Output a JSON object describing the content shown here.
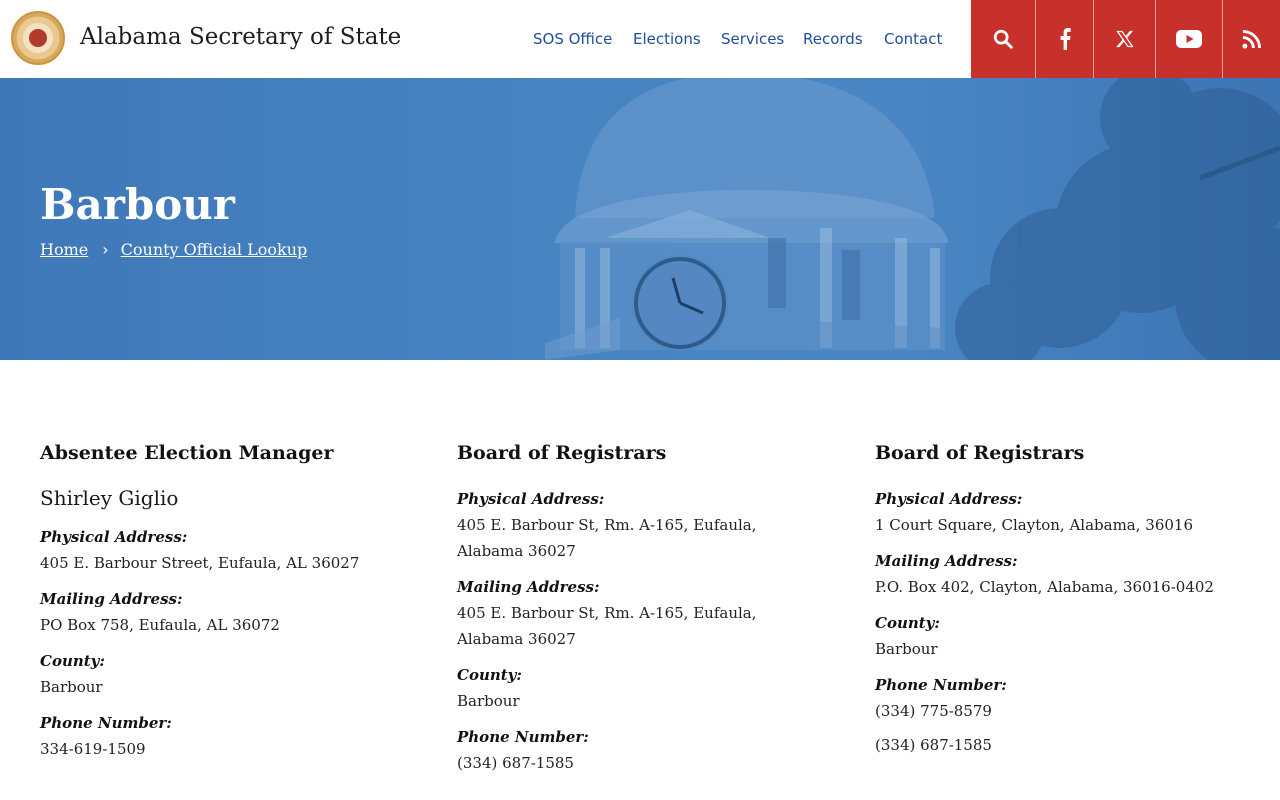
{
  "header": {
    "site_title": "Alabama Secretary of State",
    "logo_icon": "state-seal-icon",
    "nav": [
      {
        "label": "SOS Office"
      },
      {
        "label": "Elections"
      },
      {
        "label": "Services"
      },
      {
        "label": "Records"
      },
      {
        "label": "Contact"
      }
    ],
    "social": [
      {
        "icon": "search-icon"
      },
      {
        "icon": "facebook-icon"
      },
      {
        "icon": "x-twitter-icon"
      },
      {
        "icon": "youtube-icon"
      },
      {
        "icon": "rss-icon"
      }
    ],
    "accent_color": "#c8312b",
    "nav_color": "#1f4e9c"
  },
  "hero": {
    "title": "Barbour",
    "breadcrumbs": [
      {
        "label": "Home"
      },
      {
        "label": "County Official Lookup"
      }
    ],
    "separator_icon": "chevron-right-icon",
    "background_color": "#4784c2"
  },
  "columns": [
    {
      "heading": "Absentee Election Manager",
      "name": "Shirley Giglio",
      "fields": [
        {
          "label": "Physical Address:",
          "value": "405 E. Barbour Street, Eufaula, AL 36027"
        },
        {
          "label": "Mailing Address:",
          "value": "PO Box 758, Eufaula, AL 36072"
        },
        {
          "label": "County:",
          "value": "Barbour"
        },
        {
          "label": "Phone Number:",
          "value": "334-619-1509"
        }
      ]
    },
    {
      "heading": "Board of Registrars",
      "fields": [
        {
          "label": "Physical Address:",
          "value": "405 E. Barbour St, Rm. A-165, Eufaula, Alabama 36027"
        },
        {
          "label": "Mailing Address:",
          "value": "405 E. Barbour St, Rm. A-165, Eufaula, Alabama 36027"
        },
        {
          "label": "County:",
          "value": "Barbour"
        },
        {
          "label": "Phone Number:",
          "value": "(334) 687-1585"
        }
      ]
    },
    {
      "heading": "Board of Registrars",
      "fields": [
        {
          "label": "Physical Address:",
          "value": "1 Court Square, Clayton, Alabama, 36016"
        },
        {
          "label": "Mailing Address:",
          "value": "P.O. Box 402, Clayton, Alabama, 36016-0402"
        },
        {
          "label": "County:",
          "value": "Barbour"
        },
        {
          "label": "Phone Number:",
          "value": "(334) 775-8579"
        }
      ],
      "extra_phone": "(334) 687-1585"
    }
  ]
}
